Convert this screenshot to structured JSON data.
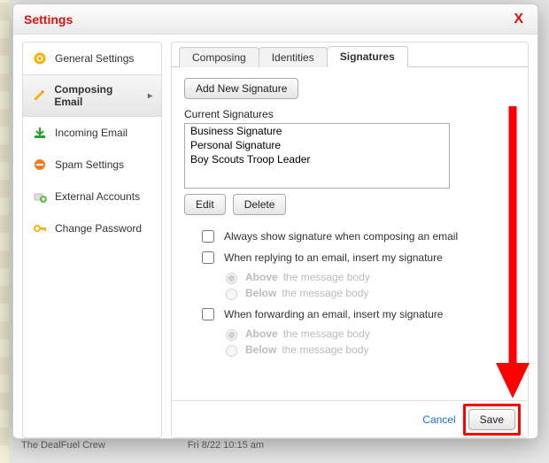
{
  "dialog": {
    "title": "Settings",
    "close_glyph": "X"
  },
  "sidebar": {
    "items": [
      {
        "label": "General Settings",
        "icon": "gear-icon",
        "selected": false
      },
      {
        "label": "Composing Email",
        "icon": "pencil-icon",
        "selected": true
      },
      {
        "label": "Incoming Email",
        "icon": "inbox-icon",
        "selected": false
      },
      {
        "label": "Spam Settings",
        "icon": "block-icon",
        "selected": false
      },
      {
        "label": "External Accounts",
        "icon": "plus-icon",
        "selected": false
      },
      {
        "label": "Change Password",
        "icon": "key-icon",
        "selected": false
      }
    ]
  },
  "tabs": {
    "items": [
      {
        "label": "Composing",
        "active": false
      },
      {
        "label": "Identities",
        "active": false
      },
      {
        "label": "Signatures",
        "active": true
      }
    ]
  },
  "sig": {
    "add_button": "Add New Signature",
    "current_label": "Current Signatures",
    "list": [
      "Business Signature",
      "Personal Signature",
      "Boy Scouts Troop Leader"
    ],
    "edit_btn": "Edit",
    "delete_btn": "Delete",
    "chk_always": "Always show signature when composing an email",
    "chk_reply": "When replying to an email, insert my signature",
    "chk_fwd": "When forwarding an email, insert my signature",
    "rad_above_b": "Above",
    "rad_above_t": " the message body",
    "rad_below_b": "Below",
    "rad_below_t": " the message body"
  },
  "footer": {
    "cancel": "Cancel",
    "save": "Save"
  },
  "background_row": {
    "col1": "The DealFuel Crew",
    "col2": "Fri 8/22 10:15 am"
  },
  "annotation": {
    "highlight_color": "#ff0000"
  }
}
